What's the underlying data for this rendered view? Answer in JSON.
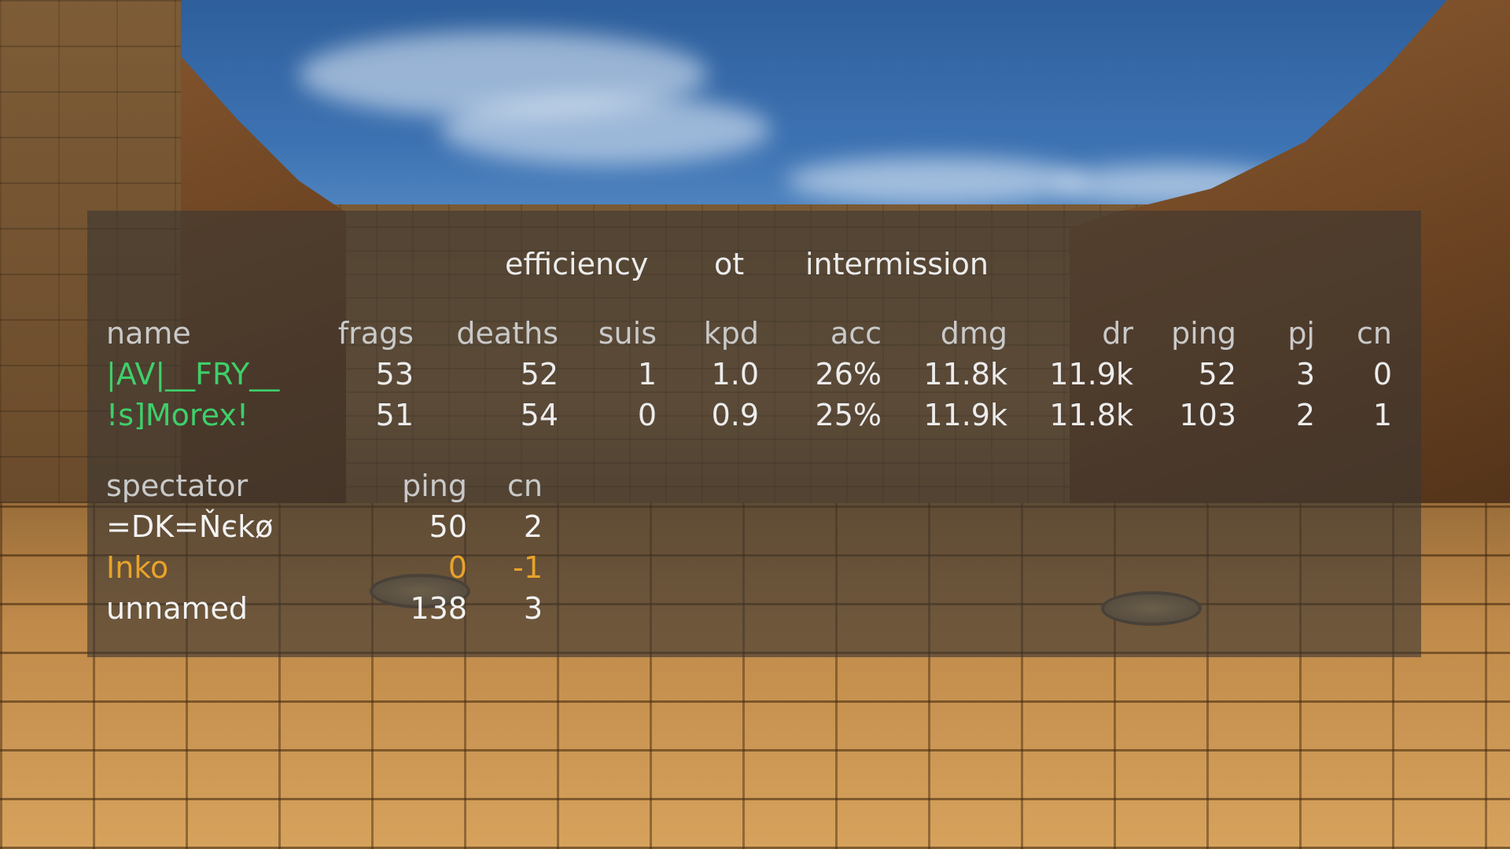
{
  "status": {
    "mode": "efficiency",
    "overtime": "ot",
    "phase": "intermission"
  },
  "players": {
    "columns": [
      "name",
      "frags",
      "deaths",
      "suis",
      "kpd",
      "acc",
      "dmg",
      "dr",
      "ping",
      "pj",
      "cn"
    ],
    "rows": [
      {
        "name": "|AV|__FRY__",
        "frags": "53",
        "deaths": "52",
        "suis": "1",
        "kpd": "1.0",
        "acc": "26%",
        "dmg": "11.8k",
        "dr": "11.9k",
        "ping": "52",
        "pj": "3",
        "cn": "0",
        "color": "#3ecf6a"
      },
      {
        "name": "!s]Morex!",
        "frags": "51",
        "deaths": "54",
        "suis": "0",
        "kpd": "0.9",
        "acc": "25%",
        "dmg": "11.9k",
        "dr": "11.8k",
        "ping": "103",
        "pj": "2",
        "cn": "1",
        "color": "#3ecf6a"
      }
    ]
  },
  "spectators": {
    "columns": [
      "spectator",
      "ping",
      "cn"
    ],
    "rows": [
      {
        "name": "=DK=Ňєkø",
        "ping": "50",
        "cn": "2",
        "color": "#f2f2f2"
      },
      {
        "name": "Inko",
        "ping": "0",
        "cn": "-1",
        "color": "#e8a32a"
      },
      {
        "name": "unnamed",
        "ping": "138",
        "cn": "3",
        "color": "#f2f2f2"
      }
    ]
  },
  "colors": {
    "panel": "#3c3732",
    "header_text": "#c9c9c9",
    "player_text": "#3ecf6a",
    "bot_text": "#e8a32a"
  }
}
